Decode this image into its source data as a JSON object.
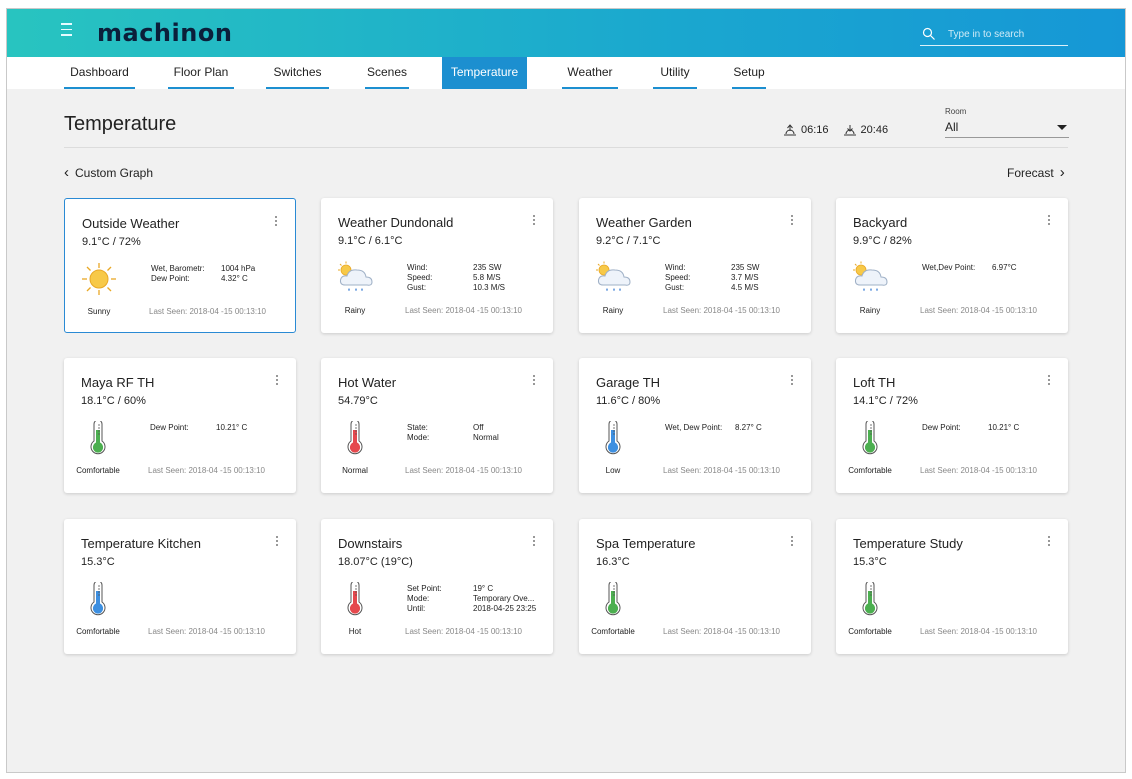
{
  "app": {
    "brand": "machinon",
    "search_placeholder": "Type in to search"
  },
  "nav": {
    "tabs": [
      {
        "label": "Dashboard",
        "active": false
      },
      {
        "label": "Floor Plan",
        "active": false
      },
      {
        "label": "Switches",
        "active": false
      },
      {
        "label": "Scenes",
        "active": false
      },
      {
        "label": "Temperature",
        "active": true
      },
      {
        "label": "Weather",
        "active": false
      },
      {
        "label": "Utility",
        "active": false
      },
      {
        "label": "Setup",
        "active": false
      }
    ]
  },
  "page": {
    "title": "Temperature",
    "sunrise": "06:16",
    "sunset": "20:46",
    "room_label": "Room",
    "room_value": "All",
    "custom_graph": "Custom Graph",
    "forecast": "Forecast"
  },
  "colors": {
    "accent": "#1c8fd0",
    "thermo_green": "#4caf50",
    "thermo_red": "#e5484d",
    "thermo_blue": "#3d8fe0"
  },
  "cards": [
    {
      "name": "Outside Weather",
      "value": "9.1°C / 72%",
      "icon": "sun-icon",
      "status": "Sunny",
      "last_seen": "Last Seen: 2018-04 -15  00:13:10",
      "details": [
        {
          "k": "Wet, Barometr:",
          "v": "1004 hPa"
        },
        {
          "k": "Dew Point:",
          "v": "4.32° C"
        }
      ],
      "selected": true
    },
    {
      "name": "Weather Dundonald",
      "value": "9.1°C /  6.1°C",
      "icon": "rain-cloud-icon",
      "status": "Rainy",
      "last_seen": "Last Seen: 2018-04 -15  00:13:10",
      "details": [
        {
          "k": "Wind:",
          "v": "235 SW"
        },
        {
          "k": "Speed:",
          "v": "5.8 M/S"
        },
        {
          "k": "Gust:",
          "v": "10.3 M/S"
        }
      ]
    },
    {
      "name": "Weather Garden",
      "value": "9.2°C /  7.1°C",
      "icon": "rain-cloud-icon",
      "status": "Rainy",
      "last_seen": "Last Seen: 2018-04 -15  00:13:10",
      "details": [
        {
          "k": "Wind:",
          "v": "235 SW"
        },
        {
          "k": "Speed:",
          "v": "3.7 M/S"
        },
        {
          "k": "Gust:",
          "v": "4.5 M/S"
        }
      ]
    },
    {
      "name": "Backyard",
      "value": "9.9°C /  82%",
      "icon": "rain-cloud-icon",
      "status": "Rainy",
      "last_seen": "Last Seen: 2018-04 -15  00:13:10",
      "details": [
        {
          "k": "Wet,Dev Point:",
          "v": "6.97°C"
        }
      ]
    },
    {
      "name": "Maya RF TH",
      "value": "18.1°C / 60%",
      "icon": "thermometer-green-icon",
      "status": "Comfortable",
      "last_seen": "Last Seen: 2018-04 -15  00:13:10",
      "details": [
        {
          "k": "Dew Point:",
          "v": "10.21° C"
        }
      ]
    },
    {
      "name": "Hot Water",
      "value": "54.79°C",
      "icon": "thermometer-red-icon",
      "status": "Normal",
      "last_seen": "Last Seen: 2018-04 -15  00:13:10",
      "details": [
        {
          "k": "State:",
          "v": "Off"
        },
        {
          "k": "Mode:",
          "v": "Normal"
        }
      ]
    },
    {
      "name": "Garage TH",
      "value": "11.6°C  / 80%",
      "icon": "thermometer-blue-icon",
      "status": "Low",
      "last_seen": "Last Seen: 2018-04 -15  00:13:10",
      "details": [
        {
          "k": "Wet, Dew Point:",
          "v": "8.27° C"
        }
      ]
    },
    {
      "name": "Loft TH",
      "value": "14.1°C / 72%",
      "icon": "thermometer-green-icon",
      "status": "Comfortable",
      "last_seen": "Last Seen: 2018-04 -15  00:13:10",
      "details": [
        {
          "k": "Dew Point:",
          "v": "10.21° C"
        }
      ]
    },
    {
      "name": "Temperature Kitchen",
      "value": "15.3°C",
      "icon": "thermometer-blue-icon",
      "status": "Comfortable",
      "last_seen": "Last Seen: 2018-04 -15  00:13:10",
      "details": []
    },
    {
      "name": "Downstairs",
      "value": "18.07°C (19°C)",
      "icon": "thermometer-red-icon",
      "status": "Hot",
      "last_seen": "Last Seen: 2018-04 -15  00:13:10",
      "details": [
        {
          "k": "Set Point:",
          "v": "19° C"
        },
        {
          "k": "Mode:",
          "v": "Temporary Ove..."
        },
        {
          "k": "Until:",
          "v": "2018-04-25 23:25"
        }
      ]
    },
    {
      "name": "Spa Temperature",
      "value": "16.3°C",
      "icon": "thermometer-green-icon",
      "status": "Comfortable",
      "last_seen": "Last Seen: 2018-04 -15  00:13:10",
      "details": []
    },
    {
      "name": "Temperature Study",
      "value": "15.3°C",
      "icon": "thermometer-green-icon",
      "status": "Comfortable",
      "last_seen": "Last Seen: 2018-04 -15  00:13:10",
      "details": []
    }
  ]
}
